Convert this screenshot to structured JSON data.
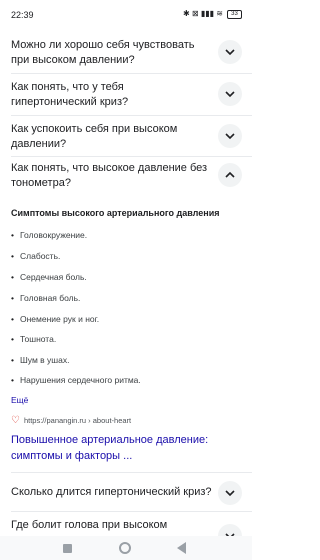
{
  "status_bar": {
    "time": "22:39",
    "time_icons": "⏰ ▪",
    "right_icons": "✱ ⊠ ▮▮▮ ≋",
    "battery": "33"
  },
  "faq": [
    {
      "question": "Можно ли хорошо себя чувствовать при высоком давлении?",
      "expanded": false
    },
    {
      "question": "Как понять, что у тебя гипертонический криз?",
      "expanded": false
    },
    {
      "question": "Как успокоить себя при высоком давлении?",
      "expanded": false
    },
    {
      "question": "Как понять, что высокое давление без тонометра?",
      "expanded": true
    },
    {
      "question": "Сколько длится гипертонический криз?",
      "expanded": false
    },
    {
      "question": "Где болит голова при высоком",
      "expanded": false
    }
  ],
  "answer": {
    "title": "Симптомы высокого артериального давления",
    "bullets": [
      "Головокружение.",
      "Слабость.",
      "Сердечная боль.",
      "Головная боль.",
      "Онемение рук и ног.",
      "Тошнота.",
      "Шум в ушах.",
      "Нарушения сердечного ритма."
    ],
    "more_label": "Ещё",
    "source_url": "https://panangin.ru › about-heart",
    "link_title": "Повышенное артериальное давление: симптомы и факторы ..."
  },
  "icons": {
    "chevron_down": "chevron-down-icon",
    "chevron_up": "chevron-up-icon",
    "favicon": "heart-icon",
    "nav": [
      "square-icon",
      "circle-icon",
      "back-triangle-icon"
    ]
  },
  "colors": {
    "link": "#1a0dab",
    "chevron_bg": "#f1f3f4",
    "favicon": "#d93025"
  }
}
